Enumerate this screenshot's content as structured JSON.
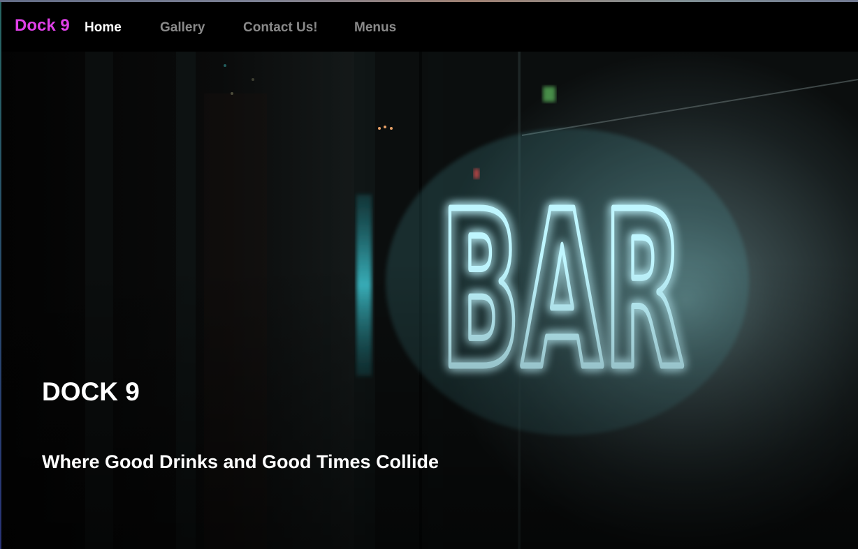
{
  "navbar": {
    "brand": "Dock 9",
    "links": [
      {
        "label": "Home",
        "active": true
      },
      {
        "label": "Gallery",
        "active": false
      },
      {
        "label": "Contact Us!",
        "active": false
      },
      {
        "label": "Menus",
        "active": false
      }
    ]
  },
  "hero": {
    "title": "DOCK 9",
    "subtitle": "Where Good Drinks and Good Times Collide",
    "neon_sign_text": "BAR"
  },
  "colors": {
    "brand": "#e040e8",
    "nav_active": "#ffffff",
    "nav_inactive": "#8a8a8a",
    "neon": "#bff6ff",
    "neon_glow": "#4fd6e0"
  }
}
